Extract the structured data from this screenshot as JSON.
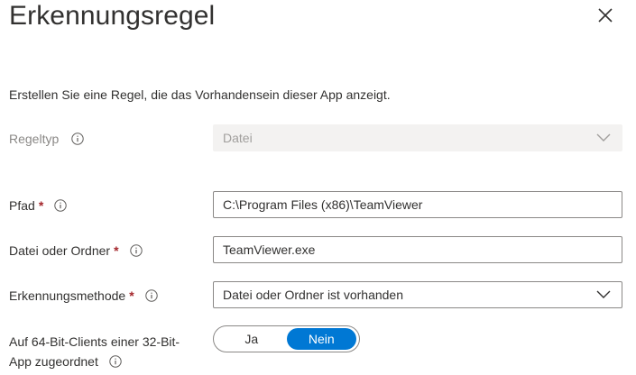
{
  "dialog": {
    "title": "Erkennungsregel",
    "description": "Erstellen Sie eine Regel, die das Vorhandensein dieser App anzeigt."
  },
  "fields": {
    "rule_type": {
      "label": "Regeltyp",
      "value": "Datei",
      "disabled": true
    },
    "path": {
      "label": "Pfad",
      "required_marker": "*",
      "value": "C:\\Program Files (x86)\\TeamViewer"
    },
    "file_or_folder": {
      "label": "Datei oder Ordner",
      "required_marker": "*",
      "value": "TeamViewer.exe"
    },
    "detection_method": {
      "label": "Erkennungsmethode",
      "required_marker": "*",
      "value": "Datei oder Ordner ist vorhanden"
    },
    "bit32_on_64": {
      "label": "Auf 64-Bit-Clients einer 32-Bit-App zugeordnet",
      "options": [
        "Ja",
        "Nein"
      ],
      "selected": "Nein"
    }
  },
  "colors": {
    "accent": "#0078d4",
    "required": "#a4262c",
    "border": "#8a8886",
    "disabled_bg": "#f3f2f1"
  },
  "icons": {
    "close": "close-icon",
    "info": "info-icon",
    "chevron": "chevron-down-icon"
  }
}
